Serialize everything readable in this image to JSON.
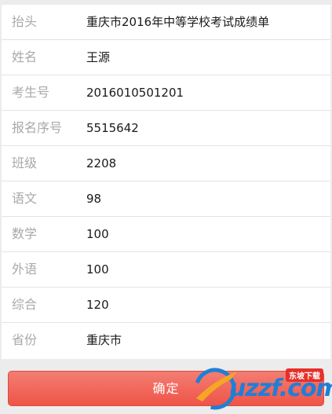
{
  "rows": [
    {
      "label": "抬头",
      "value": "重庆市2016年中等学校考试成绩单"
    },
    {
      "label": "姓名",
      "value": "王源"
    },
    {
      "label": "考生号",
      "value": "2016010501201"
    },
    {
      "label": "报名序号",
      "value": "5515642"
    },
    {
      "label": "班级",
      "value": "2208"
    },
    {
      "label": "语文",
      "value": "98"
    },
    {
      "label": "数学",
      "value": "100"
    },
    {
      "label": "外语",
      "value": "100"
    },
    {
      "label": "综合",
      "value": "120"
    },
    {
      "label": "省份",
      "value": "重庆市"
    }
  ],
  "confirm_button": {
    "label": "确定"
  },
  "watermark": {
    "text": "uzzf.com",
    "badge": "东坡下载"
  },
  "colors": {
    "button": "#ef5448",
    "label": "#a9a9a9",
    "value": "#1a1a1a",
    "watermark": "#1f7fd6"
  }
}
